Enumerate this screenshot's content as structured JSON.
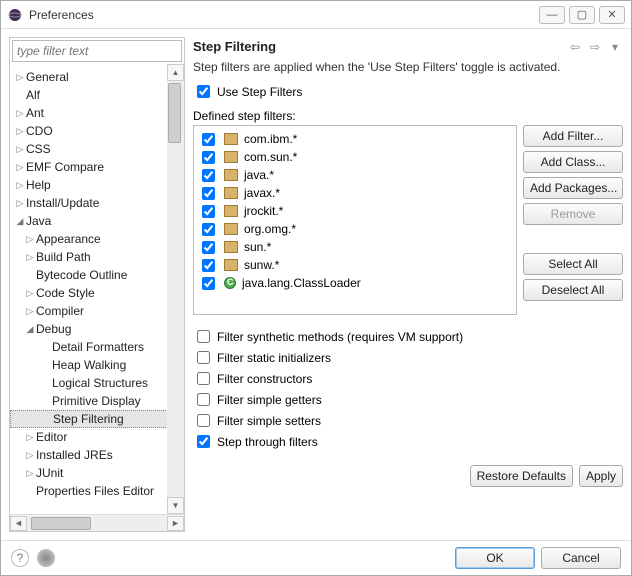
{
  "window": {
    "title": "Preferences"
  },
  "filter": {
    "placeholder": "type filter text"
  },
  "tree": [
    {
      "label": "General",
      "lvl": 0,
      "exp": "closed"
    },
    {
      "label": "Alf",
      "lvl": 0,
      "exp": "none"
    },
    {
      "label": "Ant",
      "lvl": 0,
      "exp": "closed"
    },
    {
      "label": "CDO",
      "lvl": 0,
      "exp": "closed"
    },
    {
      "label": "CSS",
      "lvl": 0,
      "exp": "closed"
    },
    {
      "label": "EMF Compare",
      "lvl": 0,
      "exp": "closed"
    },
    {
      "label": "Help",
      "lvl": 0,
      "exp": "closed"
    },
    {
      "label": "Install/Update",
      "lvl": 0,
      "exp": "closed"
    },
    {
      "label": "Java",
      "lvl": 0,
      "exp": "open"
    },
    {
      "label": "Appearance",
      "lvl": 1,
      "exp": "closed"
    },
    {
      "label": "Build Path",
      "lvl": 1,
      "exp": "closed"
    },
    {
      "label": "Bytecode Outline",
      "lvl": 1,
      "exp": "none"
    },
    {
      "label": "Code Style",
      "lvl": 1,
      "exp": "closed"
    },
    {
      "label": "Compiler",
      "lvl": 1,
      "exp": "closed"
    },
    {
      "label": "Debug",
      "lvl": 1,
      "exp": "open"
    },
    {
      "label": "Detail Formatters",
      "lvl": 2,
      "exp": "none"
    },
    {
      "label": "Heap Walking",
      "lvl": 2,
      "exp": "none"
    },
    {
      "label": "Logical Structures",
      "lvl": 2,
      "exp": "none"
    },
    {
      "label": "Primitive Display",
      "lvl": 2,
      "exp": "none"
    },
    {
      "label": "Step Filtering",
      "lvl": 2,
      "exp": "none",
      "sel": true
    },
    {
      "label": "Editor",
      "lvl": 1,
      "exp": "closed"
    },
    {
      "label": "Installed JREs",
      "lvl": 1,
      "exp": "closed"
    },
    {
      "label": "JUnit",
      "lvl": 1,
      "exp": "closed"
    },
    {
      "label": "Properties Files Editor",
      "lvl": 1,
      "exp": "none"
    }
  ],
  "page": {
    "title": "Step Filtering",
    "desc": "Step filters are applied when the 'Use Step Filters' toggle is activated.",
    "use_label": "Use Step Filters",
    "defined_label": "Defined step filters:"
  },
  "filters": [
    {
      "label": "com.ibm.*",
      "kind": "pkg",
      "checked": true
    },
    {
      "label": "com.sun.*",
      "kind": "pkg",
      "checked": true
    },
    {
      "label": "java.*",
      "kind": "pkg",
      "checked": true
    },
    {
      "label": "javax.*",
      "kind": "pkg",
      "checked": true
    },
    {
      "label": "jrockit.*",
      "kind": "pkg",
      "checked": true
    },
    {
      "label": "org.omg.*",
      "kind": "pkg",
      "checked": true
    },
    {
      "label": "sun.*",
      "kind": "pkg",
      "checked": true
    },
    {
      "label": "sunw.*",
      "kind": "pkg",
      "checked": true
    },
    {
      "label": "java.lang.ClassLoader",
      "kind": "cls",
      "checked": true
    }
  ],
  "buttons": {
    "add_filter": "Add Filter...",
    "add_class": "Add Class...",
    "add_packages": "Add Packages...",
    "remove": "Remove",
    "select_all": "Select All",
    "deselect_all": "Deselect All",
    "restore": "Restore Defaults",
    "apply": "Apply",
    "ok": "OK",
    "cancel": "Cancel"
  },
  "opts": [
    {
      "label": "Filter synthetic methods (requires VM support)",
      "checked": false
    },
    {
      "label": "Filter static initializers",
      "checked": false
    },
    {
      "label": "Filter constructors",
      "checked": false
    },
    {
      "label": "Filter simple getters",
      "checked": false
    },
    {
      "label": "Filter simple setters",
      "checked": false
    },
    {
      "label": "Step through filters",
      "checked": true
    }
  ]
}
